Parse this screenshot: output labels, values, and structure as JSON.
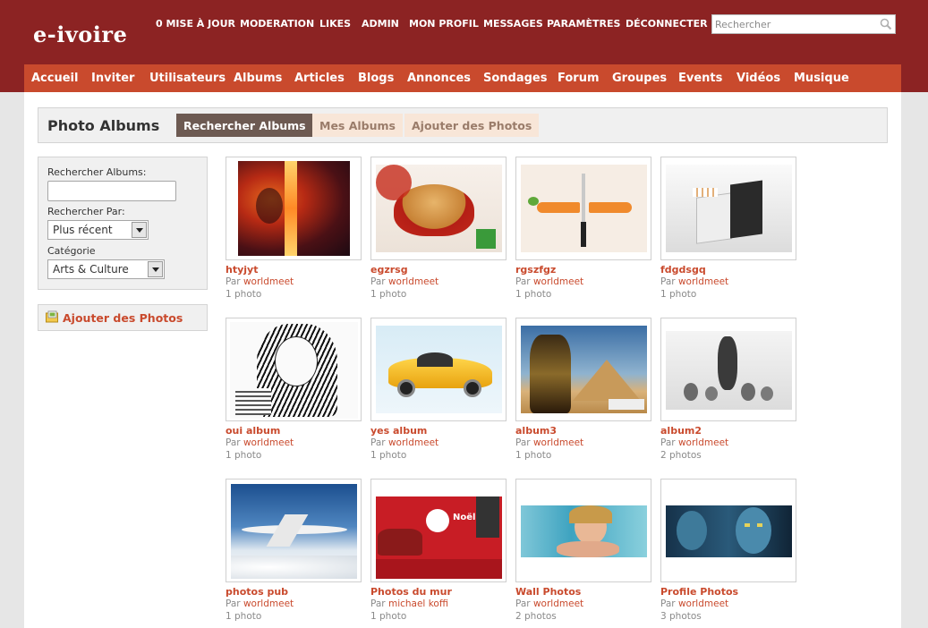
{
  "header": {
    "logo": "e-ivoire",
    "menu": [
      {
        "label": "0 MISE À JOUR"
      },
      {
        "label": "MODERATION"
      },
      {
        "label": "LIKES"
      },
      {
        "label": "ADMIN"
      },
      {
        "label": "MON PROFIL"
      },
      {
        "label": "MESSAGES"
      },
      {
        "label": "PARAMÈTRES"
      },
      {
        "label": "DÉCONNECTER"
      }
    ],
    "search_placeholder": "Rechercher"
  },
  "nav": [
    {
      "label": "Accueil"
    },
    {
      "label": "Inviter"
    },
    {
      "label": "Utilisateurs"
    },
    {
      "label": "Albums"
    },
    {
      "label": "Articles"
    },
    {
      "label": "Blogs"
    },
    {
      "label": "Annonces"
    },
    {
      "label": "Sondages"
    },
    {
      "label": "Forum"
    },
    {
      "label": "Groupes"
    },
    {
      "label": "Events"
    },
    {
      "label": "Vidéos"
    },
    {
      "label": "Musique"
    }
  ],
  "page": {
    "title": "Photo Albums",
    "tabs": [
      {
        "label": "Rechercher Albums",
        "active": true
      },
      {
        "label": "Mes Albums",
        "active": false
      },
      {
        "label": "Ajouter des Photos",
        "active": false
      }
    ]
  },
  "sidebar": {
    "search_label": "Rechercher Albums:",
    "search_value": "",
    "sort_label": "Rechercher Par:",
    "sort_value": "Plus récent",
    "category_label": "Catégorie",
    "category_value": "Arts & Culture",
    "add_photos": "Ajouter des Photos"
  },
  "by_prefix": "Par",
  "albums": [
    {
      "title": "htyjyt",
      "author": "worldmeet",
      "count": "1 photo",
      "icon": "fire-dancer-art-photo"
    },
    {
      "title": "egzrsg",
      "author": "worldmeet",
      "count": "1 photo",
      "icon": "burger-splash-ad-photo"
    },
    {
      "title": "rgszfgz",
      "author": "worldmeet",
      "count": "1 photo",
      "icon": "carrot-knife-ad-photo"
    },
    {
      "title": "fdgdsgq",
      "author": "worldmeet",
      "count": "1 photo",
      "icon": "cigarette-pack-ad-photo"
    },
    {
      "title": "oui album",
      "author": "worldmeet",
      "count": "1 photo",
      "icon": "typographic-portrait-photo"
    },
    {
      "title": "yes album",
      "author": "worldmeet",
      "count": "1 photo",
      "icon": "yellow-sports-car-photo"
    },
    {
      "title": "album3",
      "author": "worldmeet",
      "count": "1 photo",
      "icon": "pharaoh-pyramid-photo"
    },
    {
      "title": "album2",
      "author": "worldmeet",
      "count": "2 photos",
      "icon": "sculpture-figures-photo"
    },
    {
      "title": "photos pub",
      "author": "worldmeet",
      "count": "1 photo",
      "icon": "airplane-sky-photo"
    },
    {
      "title": "Photos du mur",
      "author": "michael koffi",
      "count": "1 photo",
      "icon": "christmas-noel-ad-photo"
    },
    {
      "title": "Wall Photos",
      "author": "worldmeet",
      "count": "2 photos",
      "icon": "woman-beach-photo"
    },
    {
      "title": "Profile Photos",
      "author": "worldmeet",
      "count": "3 photos",
      "icon": "avatar-movie-photo"
    }
  ],
  "colors": {
    "header": "#8c2323",
    "nav": "#c94a2d",
    "link": "#c94a2d",
    "tab_active": "#6d5a52",
    "tab_inactive": "#f8e6d8"
  }
}
